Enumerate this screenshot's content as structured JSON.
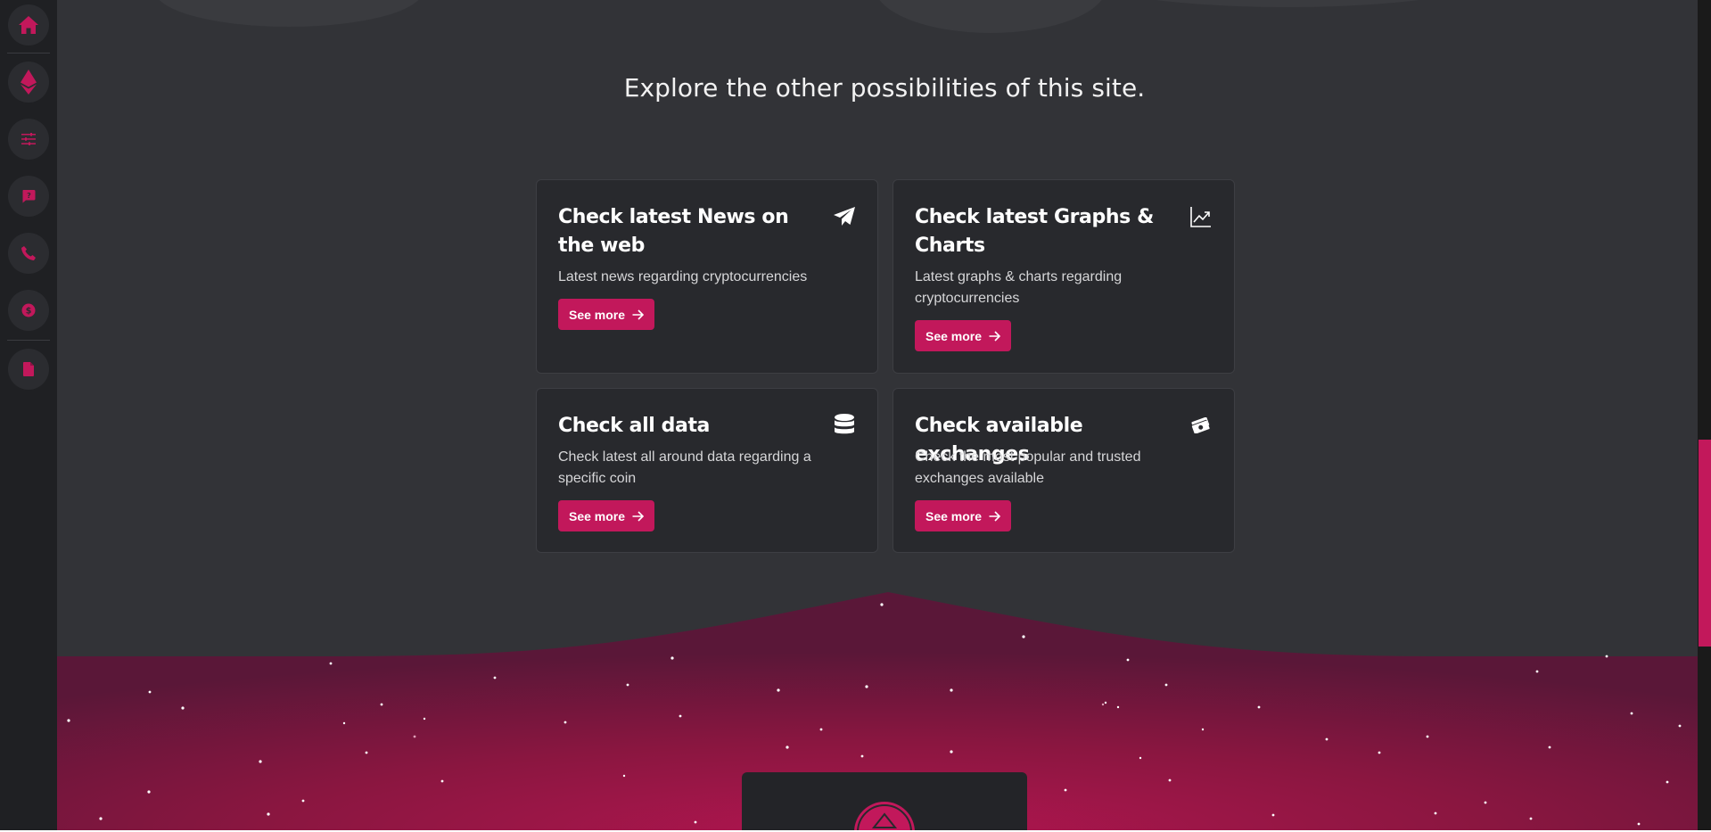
{
  "sidebar": {
    "items": [
      {
        "icon": "home-icon"
      },
      {
        "icon": "ethereum-icon"
      },
      {
        "icon": "sliders-icon"
      },
      {
        "icon": "question-message-icon"
      },
      {
        "icon": "phone-icon"
      },
      {
        "icon": "coin-icon"
      },
      {
        "icon": "document-icon"
      }
    ]
  },
  "main": {
    "heading": "Explore the other possibilities of this site.",
    "cards": [
      {
        "title": "Check latest News on the web",
        "description": "Latest news regarding cryptocurrencies",
        "button": "See more",
        "icon": "paper-plane-icon"
      },
      {
        "title": "Check latest Graphs & Charts",
        "description": "Latest graphs & charts regarding cryptocurrencies",
        "button": "See more",
        "icon": "chart-line-icon"
      },
      {
        "title": "Check all data",
        "description": "Check latest all around data regarding a specific coin",
        "button": "See more",
        "icon": "database-icon"
      },
      {
        "title": "Check available exchanges",
        "description": "Check the most popular and trusted exchanges available",
        "button": "See more",
        "icon": "money-bills-icon"
      }
    ]
  },
  "colors": {
    "accent": "#c2185b",
    "sidebar_bg": "#1f2023",
    "main_bg": "#323337",
    "card_bg": "#28292d"
  }
}
